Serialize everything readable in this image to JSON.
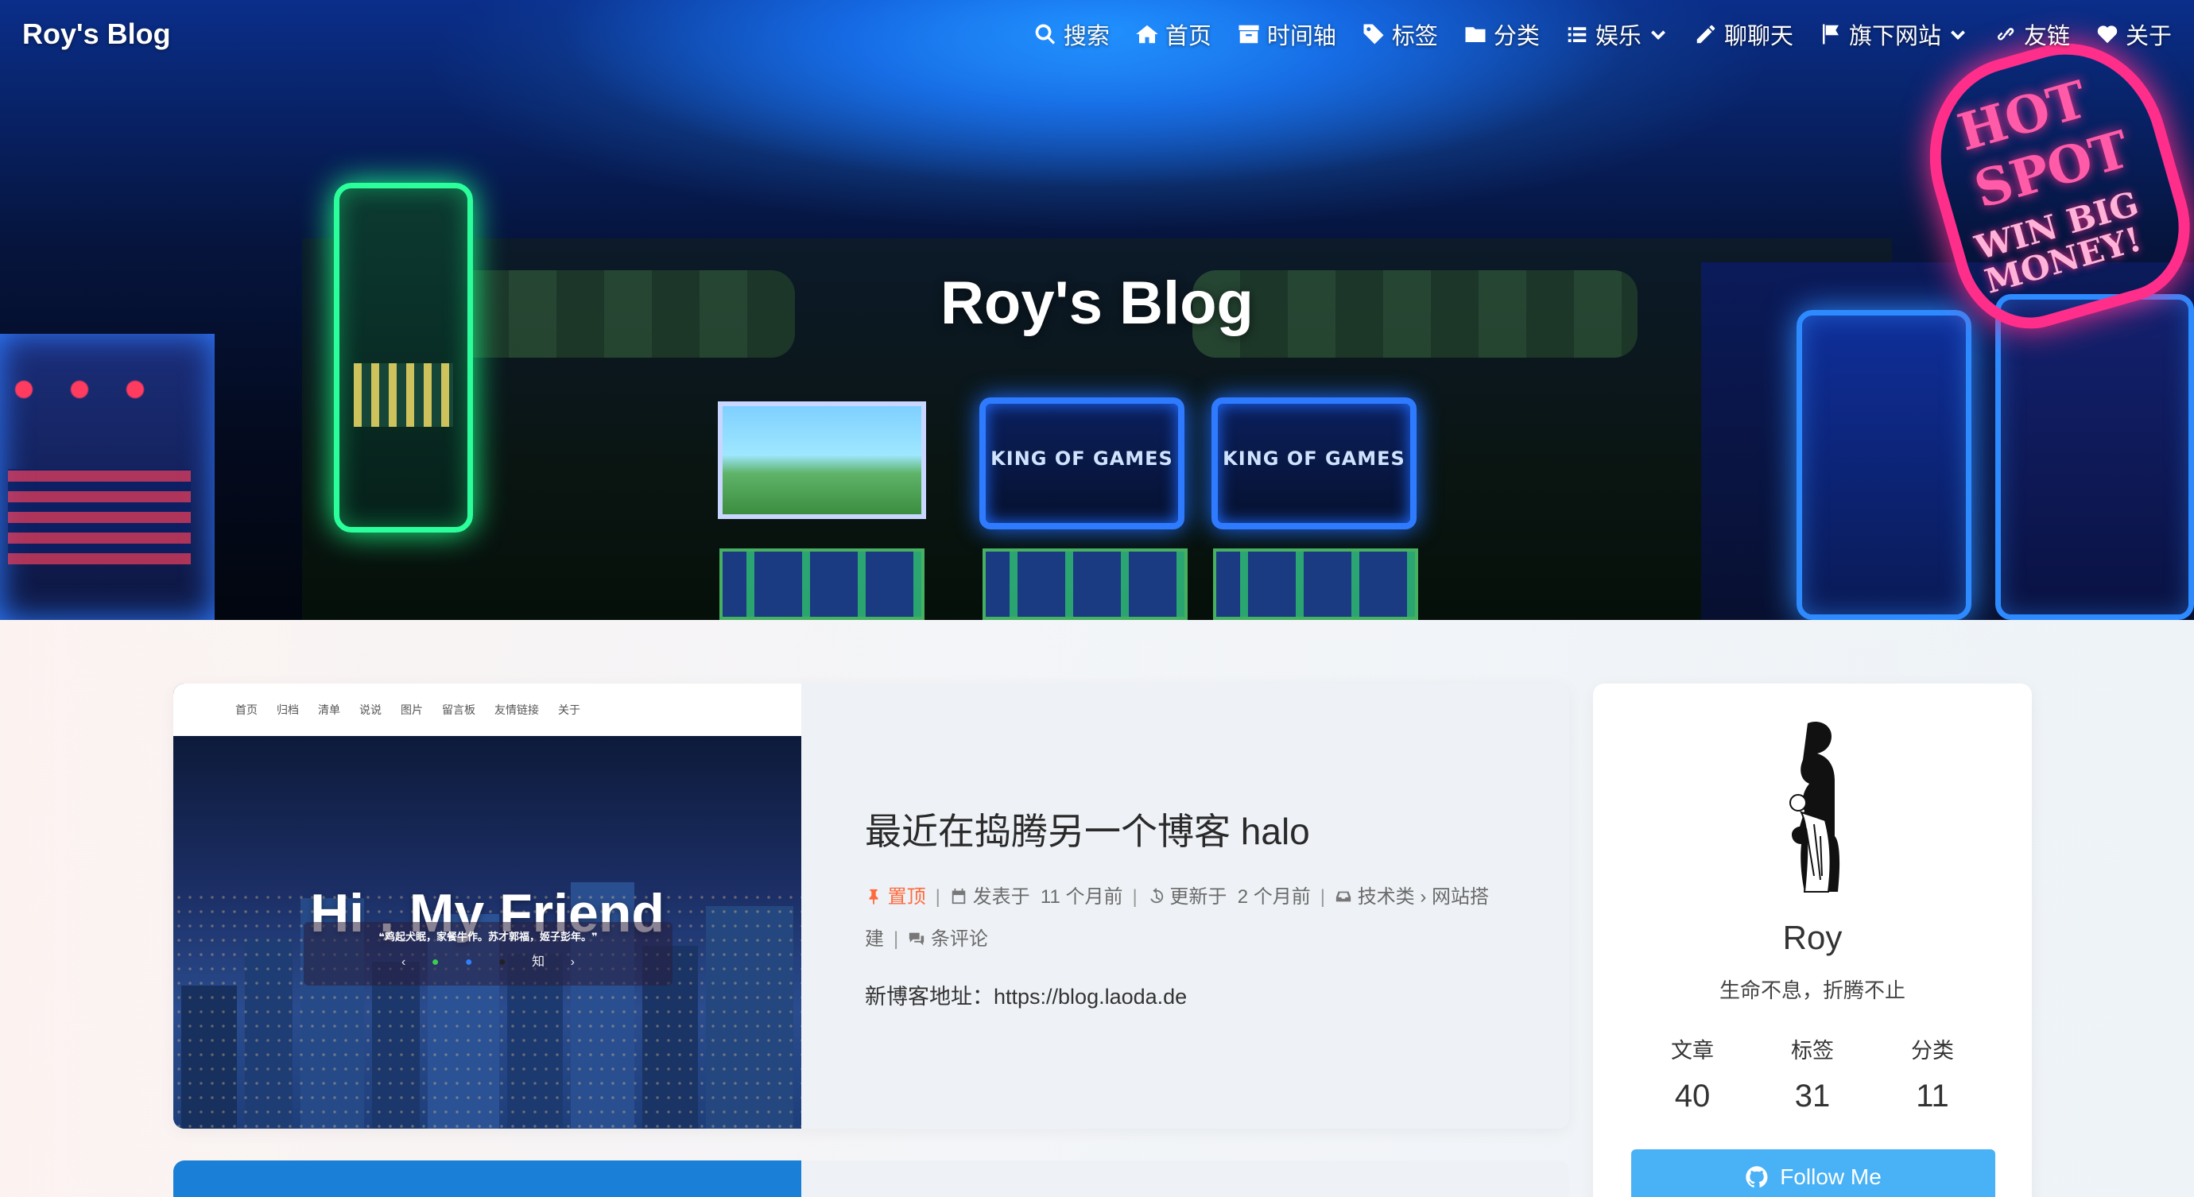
{
  "site": {
    "brand": "Roy's Blog",
    "hero_title": "Roy's Blog"
  },
  "nav": {
    "items": [
      {
        "label": "搜索",
        "icon": "search-icon"
      },
      {
        "label": "首页",
        "icon": "home-icon"
      },
      {
        "label": "时间轴",
        "icon": "archive-icon"
      },
      {
        "label": "标签",
        "icon": "tags-icon"
      },
      {
        "label": "分类",
        "icon": "folder-icon"
      },
      {
        "label": "娱乐",
        "icon": "list-icon",
        "dropdown": true
      },
      {
        "label": "聊聊天",
        "icon": "pencil-icon"
      },
      {
        "label": "旗下网站",
        "icon": "flag-icon",
        "dropdown": true
      },
      {
        "label": "友链",
        "icon": "link-icon"
      },
      {
        "label": "关于",
        "icon": "heart-icon"
      }
    ]
  },
  "post": {
    "thumbnail": {
      "nav_items": [
        "首页",
        "归档",
        "清单",
        "说说",
        "图片",
        "留言板",
        "友情链接",
        "关于"
      ],
      "headline": "Hi , My Friend",
      "quote": "❝鸡起犬眠，家餐牛作。苏才郭福，姬子彭年。❞",
      "icons": [
        "‹",
        "●",
        "●",
        "●",
        "知",
        "›"
      ]
    },
    "title": "最近在捣腾另一个博客 halo",
    "pinned_label": "置顶",
    "published_label": "发表于",
    "published_value": "11 个月前",
    "updated_label": "更新于",
    "updated_value": "2 个月前",
    "category_1": "技术类",
    "category_2": "网站搭建",
    "comments_label": "条评论",
    "excerpt": "新博客地址：https://blog.laoda.de"
  },
  "profile": {
    "name": "Roy",
    "motto": "生命不息，折腾不止",
    "stats": [
      {
        "label": "文章",
        "value": "40"
      },
      {
        "label": "标签",
        "value": "31"
      },
      {
        "label": "分类",
        "value": "11"
      }
    ],
    "follow_label": "Follow Me"
  },
  "colors": {
    "accent": "#49b1f5",
    "pin": "#ff6a3d"
  }
}
